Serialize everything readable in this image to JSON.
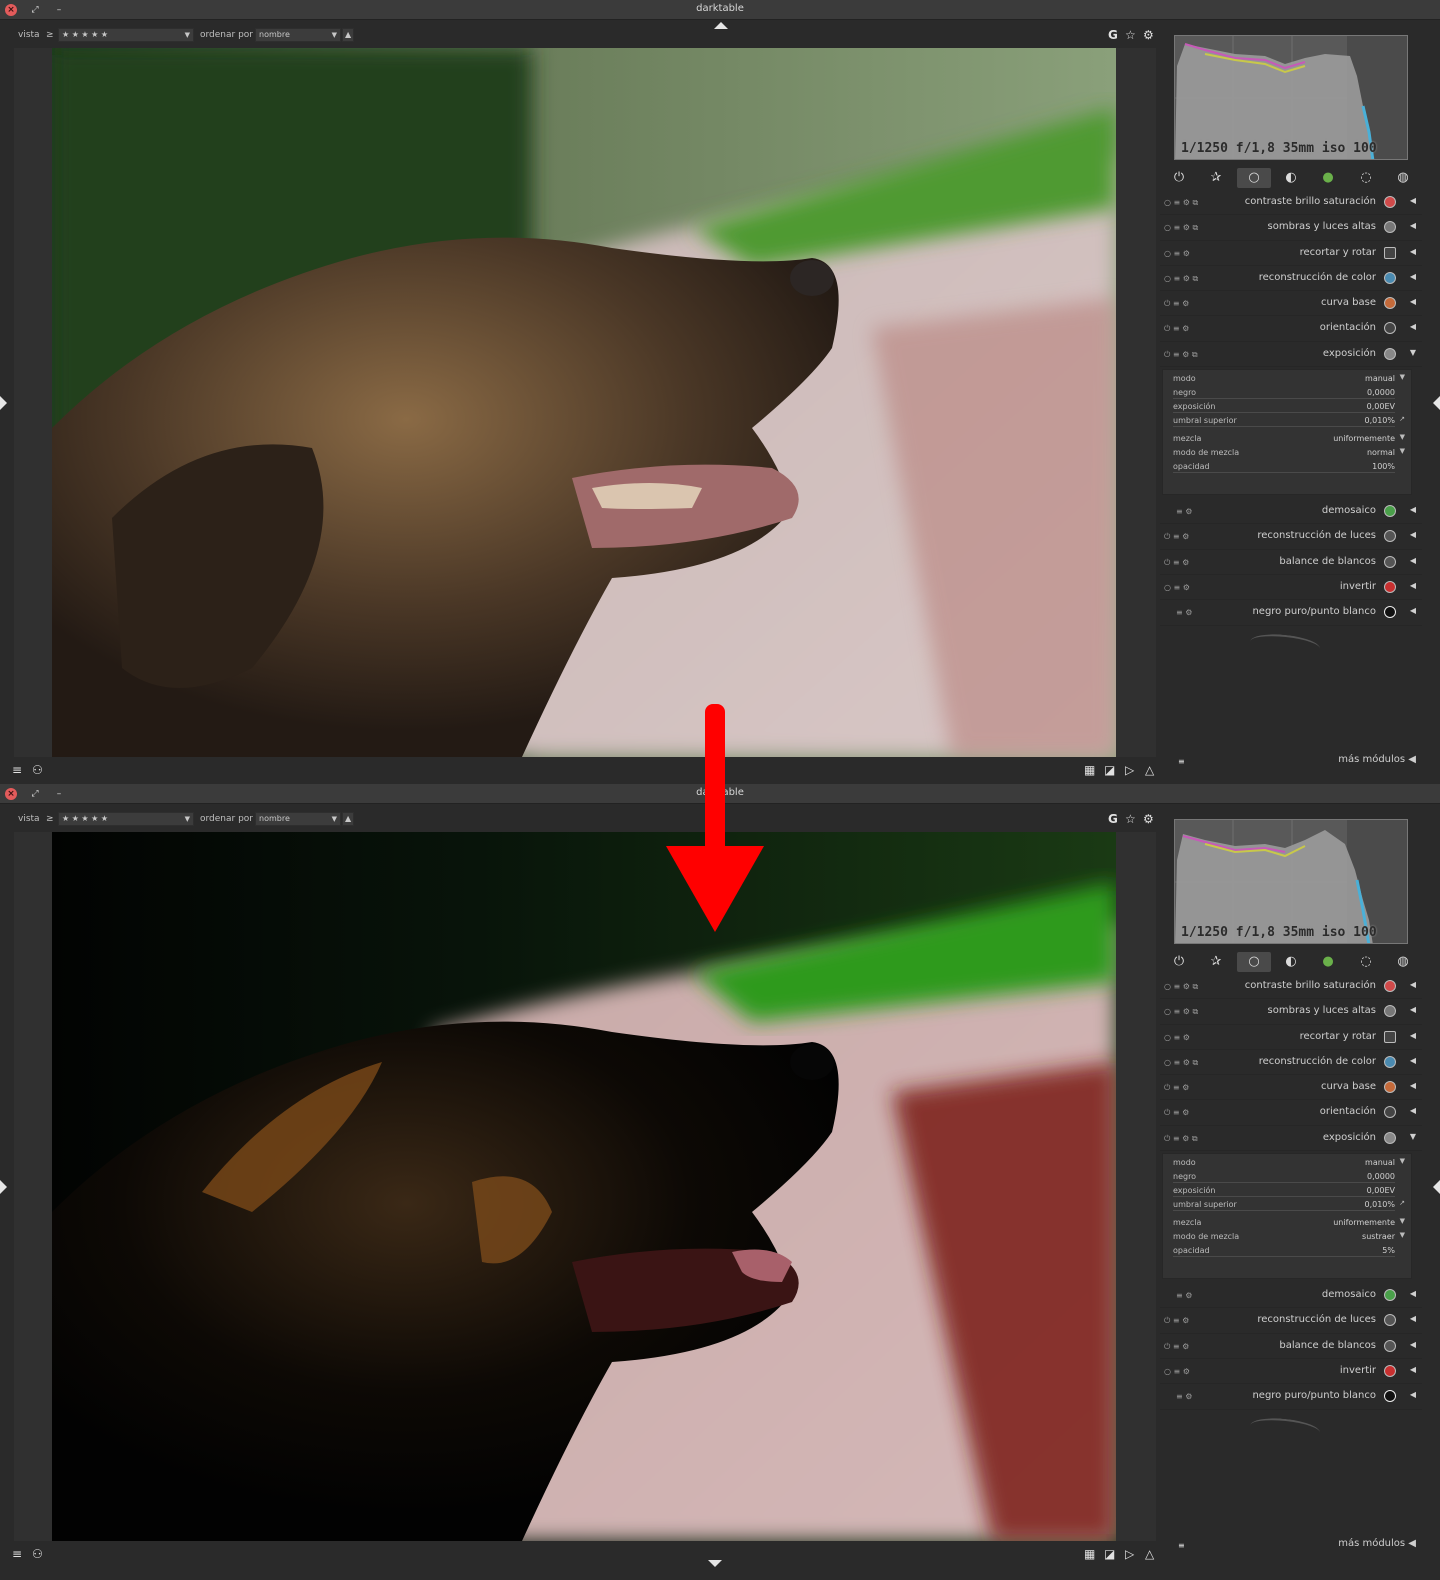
{
  "window": {
    "title": "darktable"
  },
  "toolbar": {
    "vista_label": "vista",
    "comparator": "≥",
    "rating_value": "★ ★ ★ ★ ★",
    "sort_label": "ordenar por",
    "sort_value": "nombre",
    "icons": [
      "G",
      "☆",
      "⚙"
    ]
  },
  "histogram": {
    "exif": "1/1250 f/1,8 35mm iso 100"
  },
  "module_groups": [
    "power-icon",
    "star-icon",
    "circle-icon",
    "tone-icon",
    "color-icon",
    "correct-icon",
    "effect-icon"
  ],
  "modules": [
    {
      "name": "contraste brillo saturación",
      "color": "#d04a4a"
    },
    {
      "name": "sombras y luces altas",
      "color": "#777777"
    },
    {
      "name": "recortar y rotar",
      "color": "#444444"
    },
    {
      "name": "reconstrucción de color",
      "color": "#4a8ab0"
    },
    {
      "name": "curva base",
      "color": "#c46a3a"
    },
    {
      "name": "orientación",
      "color": "#444444"
    },
    {
      "name": "exposición",
      "color": "#888888"
    }
  ],
  "modules_after": [
    {
      "name": "demosaico",
      "color": "#4aa04a"
    },
    {
      "name": "reconstrucción de luces",
      "color": "#555555"
    },
    {
      "name": "balance de blancos",
      "color": "#555555"
    },
    {
      "name": "invertir",
      "color": "#c83030"
    },
    {
      "name": "negro puro/punto blanco",
      "color": "#111111"
    }
  ],
  "exposure_before": {
    "modo_label": "modo",
    "modo_value": "manual",
    "negro_label": "negro",
    "negro_value": "0,0000",
    "exposicion_label": "exposición",
    "exposicion_value": "0,00EV",
    "umbral_label": "umbral superior",
    "umbral_value": "0,010%",
    "mezcla_label": "mezcla",
    "mezcla_value": "uniformemente",
    "modo_mezcla_label": "modo de mezcla",
    "modo_mezcla_value": "normal",
    "opacidad_label": "opacidad",
    "opacidad_value": "100%"
  },
  "exposure_after": {
    "modo_label": "modo",
    "modo_value": "manual",
    "negro_label": "negro",
    "negro_value": "0,0000",
    "exposicion_label": "exposición",
    "exposicion_value": "0,00EV",
    "umbral_label": "umbral superior",
    "umbral_value": "0,010%",
    "mezcla_label": "mezcla",
    "mezcla_value": "uniformemente",
    "modo_mezcla_label": "modo de mezcla",
    "modo_mezcla_value": "sustraer",
    "opacidad_label": "opacidad",
    "opacidad_value": "5%"
  },
  "more_modules": "más módulos",
  "bottom_icons": {
    "left": [
      "≡",
      "⚇"
    ],
    "right": [
      "▦",
      "◪",
      "▷",
      "△"
    ]
  },
  "colors": {
    "accent_arrow": "#ff0000",
    "panel_bg": "#2a2a2a",
    "close_button": "#e35b5b"
  }
}
